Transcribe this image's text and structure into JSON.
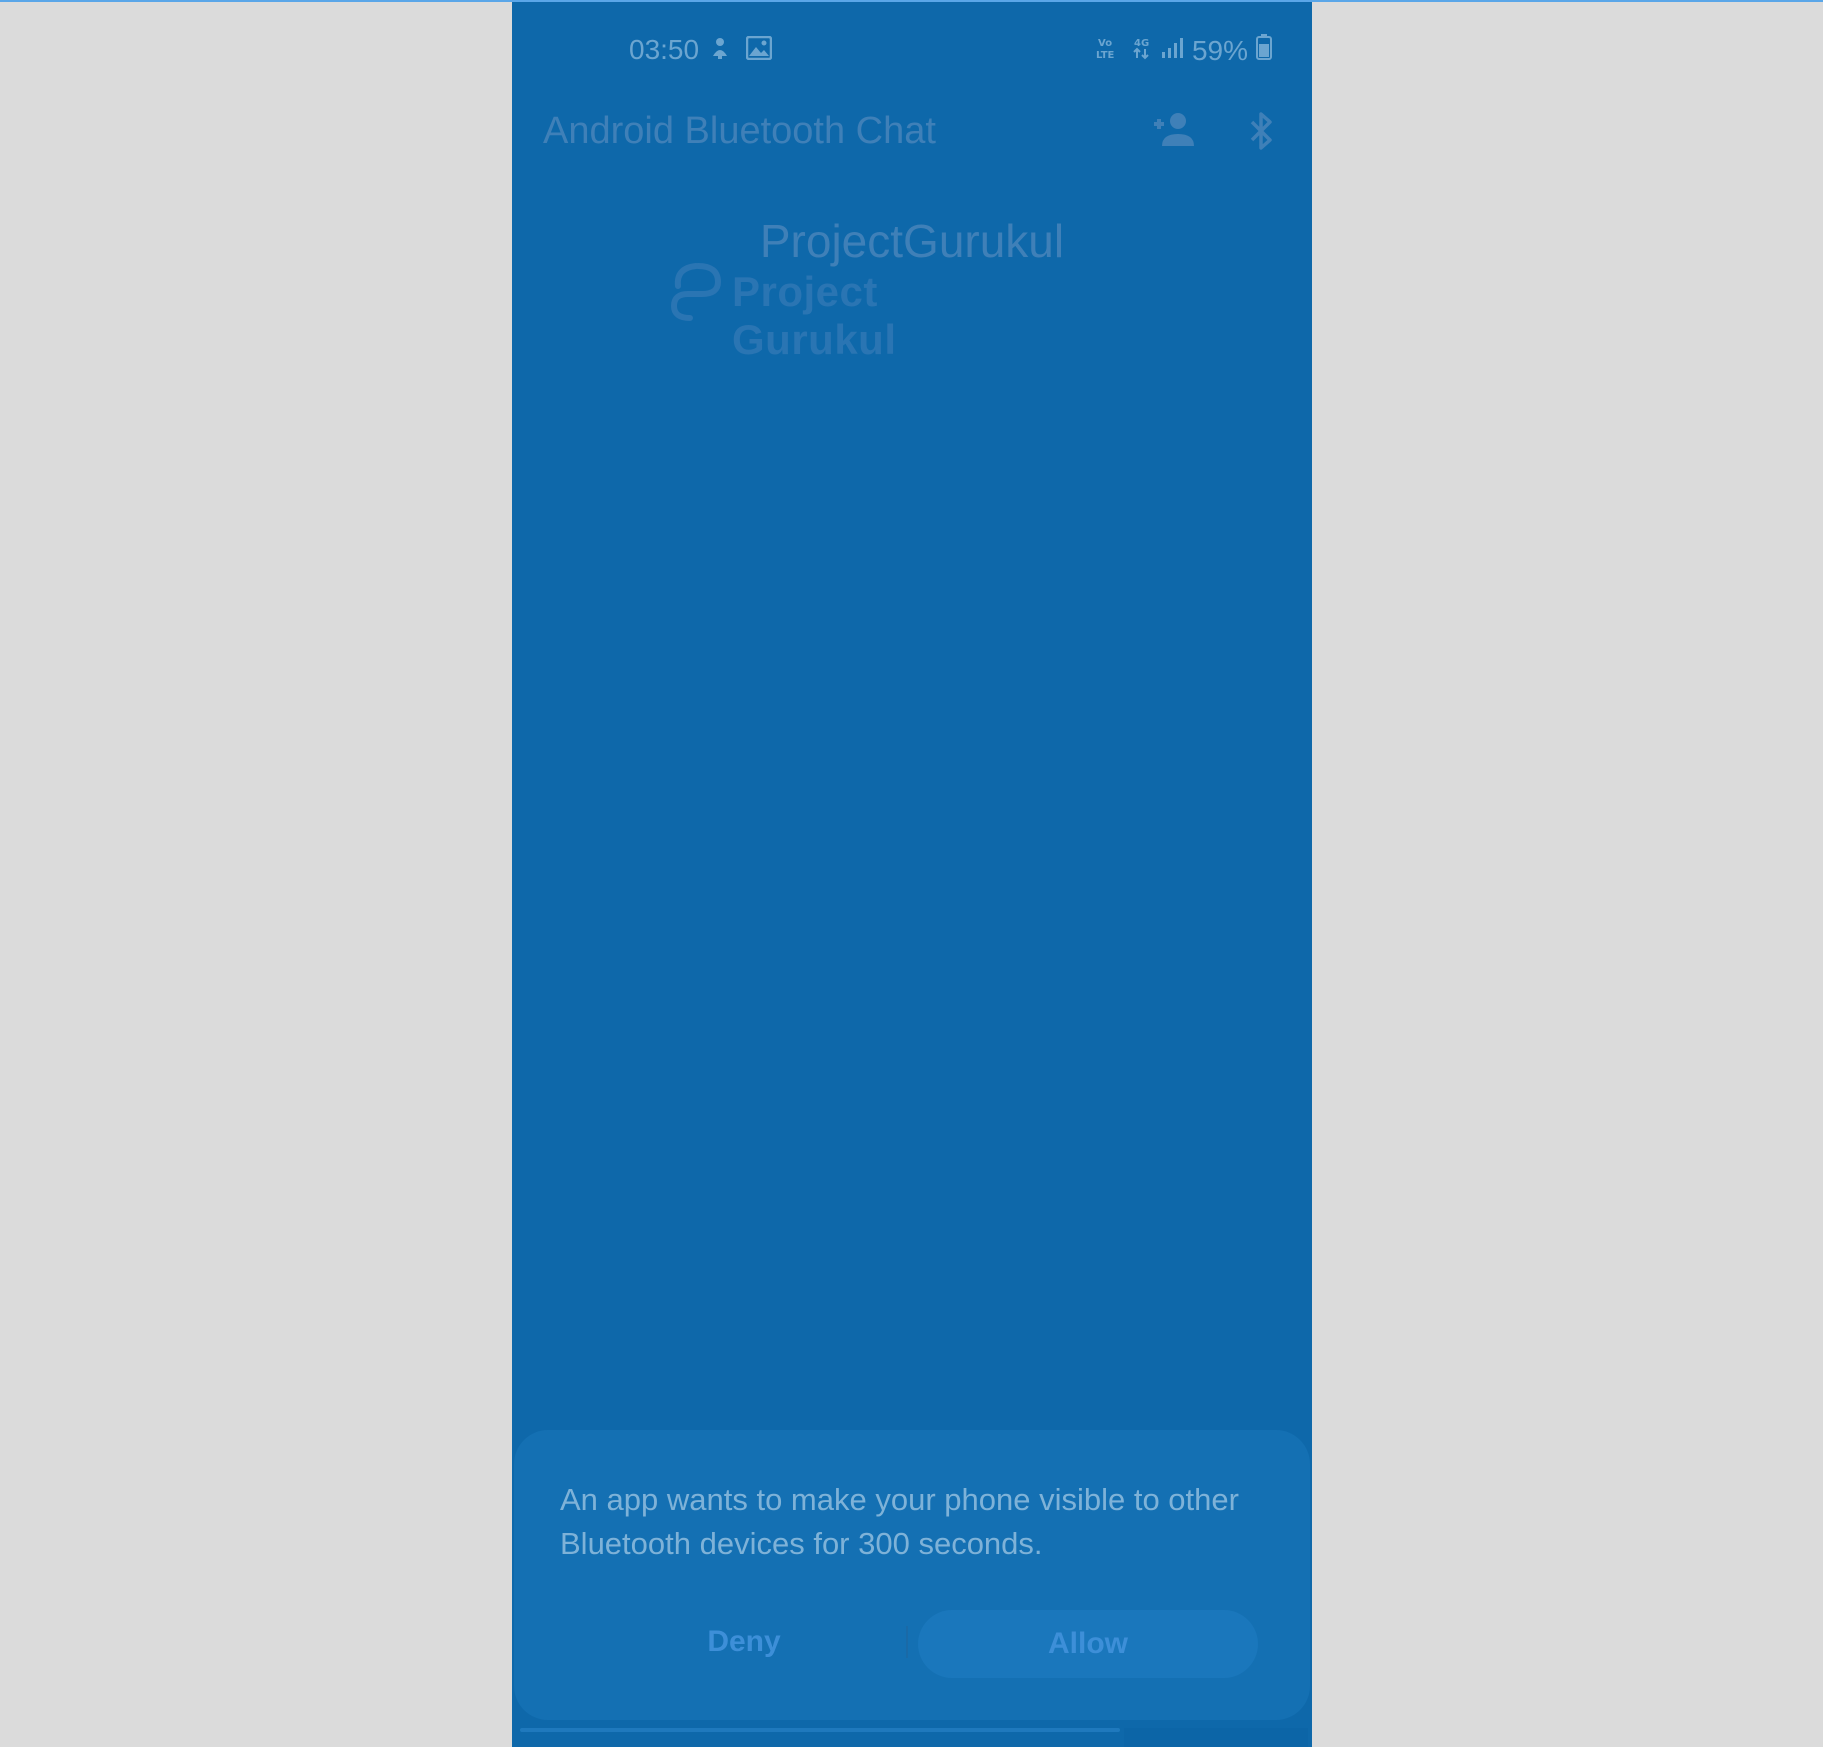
{
  "status_bar": {
    "time": "03:50",
    "battery": "59%",
    "icons": {
      "notification": "person-upload-icon",
      "gallery": "image-icon",
      "volte": "volte-icon",
      "network": "4g-data-icon",
      "signal": "signal-bars-icon",
      "battery": "battery-icon"
    }
  },
  "app_bar": {
    "title": "Android Bluetooth Chat",
    "actions": [
      "add-person-icon",
      "bluetooth-icon"
    ]
  },
  "brand": {
    "heading": "ProjectGurukul",
    "logo_text": "Project Gurukul"
  },
  "dialog": {
    "message": "An app wants to make your phone visible to other Bluetooth devices for 300 seconds.",
    "deny_label": "Deny",
    "allow_label": "Allow"
  },
  "colors": {
    "page_background": "#dbdbdb",
    "phone_background": "#0e68aa",
    "dialog_background": "#1470b3",
    "accent": "#3d8fd8"
  }
}
